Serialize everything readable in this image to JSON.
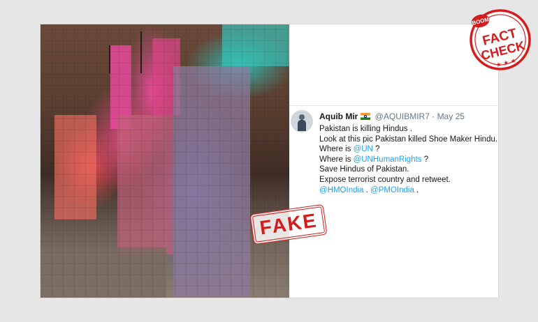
{
  "stamp": {
    "text": "FAKE",
    "color": "#d51b1b"
  },
  "logo": {
    "top_text": "BOOM",
    "line1": "FACT",
    "line2": "CHECK",
    "stars": "★ ★ ★",
    "color": "#d51b1b"
  },
  "tweet": {
    "display_name": "Aquib Mir",
    "handle": "@AQUIBMIR7",
    "separator": "·",
    "date": "May 25",
    "line1": "Pakistan is killing Hindus .",
    "line2": "Look at this pic Pakistan killed Shoe Maker Hindu.",
    "line3_prefix": "Where is ",
    "line3_link": "@UN",
    "line3_suffix": " ?",
    "line4_prefix": "Where is ",
    "line4_link": "@UNHumanRights",
    "line4_suffix": " ?",
    "line5": "Save Hindus of Pakistan.",
    "line6": "Expose terrorist country and retweet.",
    "mention1": "@HMOIndia",
    "mention_sep": " . ",
    "mention2": "@PMOIndia",
    "mention_end": " .",
    "link_color": "#1da1f2"
  }
}
